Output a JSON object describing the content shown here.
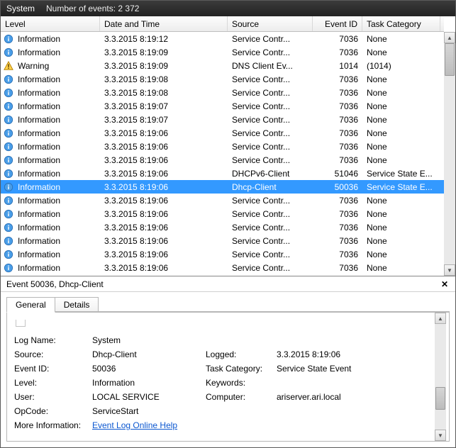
{
  "header": {
    "title": "System",
    "count_label": "Number of events: 2 372"
  },
  "columns": {
    "level": "Level",
    "datetime": "Date and Time",
    "source": "Source",
    "eventid": "Event ID",
    "taskcat": "Task Category"
  },
  "rows": [
    {
      "level": "Information",
      "icon": "info",
      "dt": "3.3.2015 8:19:12",
      "src": "Service Contr...",
      "id": "7036",
      "tc": "None"
    },
    {
      "level": "Information",
      "icon": "info",
      "dt": "3.3.2015 8:19:09",
      "src": "Service Contr...",
      "id": "7036",
      "tc": "None"
    },
    {
      "level": "Warning",
      "icon": "warn",
      "dt": "3.3.2015 8:19:09",
      "src": "DNS Client Ev...",
      "id": "1014",
      "tc": "(1014)"
    },
    {
      "level": "Information",
      "icon": "info",
      "dt": "3.3.2015 8:19:08",
      "src": "Service Contr...",
      "id": "7036",
      "tc": "None"
    },
    {
      "level": "Information",
      "icon": "info",
      "dt": "3.3.2015 8:19:08",
      "src": "Service Contr...",
      "id": "7036",
      "tc": "None"
    },
    {
      "level": "Information",
      "icon": "info",
      "dt": "3.3.2015 8:19:07",
      "src": "Service Contr...",
      "id": "7036",
      "tc": "None"
    },
    {
      "level": "Information",
      "icon": "info",
      "dt": "3.3.2015 8:19:07",
      "src": "Service Contr...",
      "id": "7036",
      "tc": "None"
    },
    {
      "level": "Information",
      "icon": "info",
      "dt": "3.3.2015 8:19:06",
      "src": "Service Contr...",
      "id": "7036",
      "tc": "None"
    },
    {
      "level": "Information",
      "icon": "info",
      "dt": "3.3.2015 8:19:06",
      "src": "Service Contr...",
      "id": "7036",
      "tc": "None"
    },
    {
      "level": "Information",
      "icon": "info",
      "dt": "3.3.2015 8:19:06",
      "src": "Service Contr...",
      "id": "7036",
      "tc": "None"
    },
    {
      "level": "Information",
      "icon": "info",
      "dt": "3.3.2015 8:19:06",
      "src": "DHCPv6-Client",
      "id": "51046",
      "tc": "Service State E..."
    },
    {
      "level": "Information",
      "icon": "info",
      "dt": "3.3.2015 8:19:06",
      "src": "Dhcp-Client",
      "id": "50036",
      "tc": "Service State E...",
      "selected": true
    },
    {
      "level": "Information",
      "icon": "info",
      "dt": "3.3.2015 8:19:06",
      "src": "Service Contr...",
      "id": "7036",
      "tc": "None"
    },
    {
      "level": "Information",
      "icon": "info",
      "dt": "3.3.2015 8:19:06",
      "src": "Service Contr...",
      "id": "7036",
      "tc": "None"
    },
    {
      "level": "Information",
      "icon": "info",
      "dt": "3.3.2015 8:19:06",
      "src": "Service Contr...",
      "id": "7036",
      "tc": "None"
    },
    {
      "level": "Information",
      "icon": "info",
      "dt": "3.3.2015 8:19:06",
      "src": "Service Contr...",
      "id": "7036",
      "tc": "None"
    },
    {
      "level": "Information",
      "icon": "info",
      "dt": "3.3.2015 8:19:06",
      "src": "Service Contr...",
      "id": "7036",
      "tc": "None"
    },
    {
      "level": "Information",
      "icon": "info",
      "dt": "3.3.2015 8:19:06",
      "src": "Service Contr...",
      "id": "7036",
      "tc": "None"
    }
  ],
  "detail": {
    "title": "Event 50036, Dhcp-Client",
    "tabs": {
      "general": "General",
      "details": "Details"
    },
    "fields": {
      "logname_l": "Log Name:",
      "logname_v": "System",
      "source_l": "Source:",
      "source_v": "Dhcp-Client",
      "logged_l": "Logged:",
      "logged_v": "3.3.2015 8:19:06",
      "eventid_l": "Event ID:",
      "eventid_v": "50036",
      "taskcat_l": "Task Category:",
      "taskcat_v": "Service State Event",
      "level_l": "Level:",
      "level_v": "Information",
      "keywords_l": "Keywords:",
      "keywords_v": "",
      "user_l": "User:",
      "user_v": "LOCAL SERVICE",
      "computer_l": "Computer:",
      "computer_v": "ariserver.ari.local",
      "opcode_l": "OpCode:",
      "opcode_v": "ServiceStart",
      "moreinfo_l": "More Information:",
      "moreinfo_v": "Event Log Online Help"
    }
  }
}
